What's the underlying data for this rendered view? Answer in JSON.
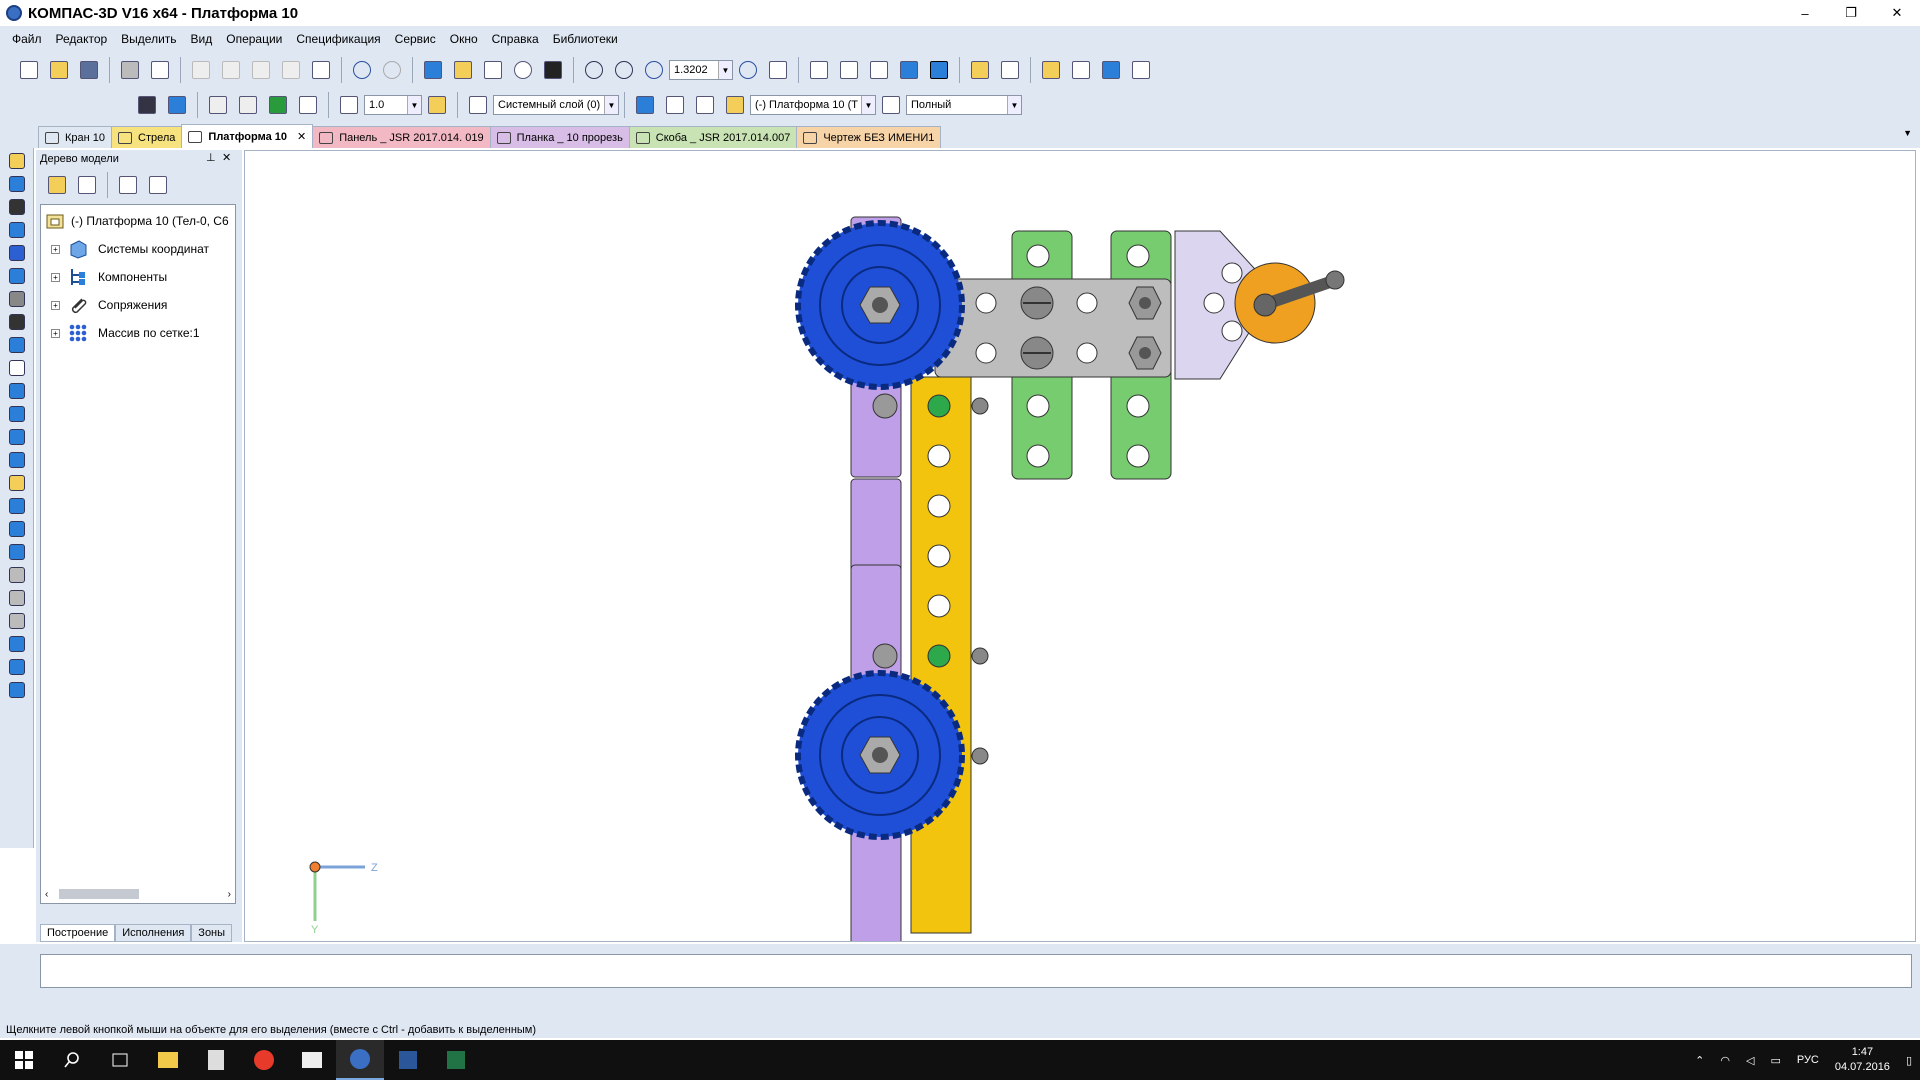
{
  "window": {
    "title": "КОМПАС-3D V16  x64 - Платформа 10",
    "min": "–",
    "restore": "❐",
    "close": "✕"
  },
  "menu": [
    "Файл",
    "Редактор",
    "Выделить",
    "Вид",
    "Операции",
    "Спецификация",
    "Сервис",
    "Окно",
    "Справка",
    "Библиотеки"
  ],
  "toolbar1": {
    "zoom_value": "1.3202"
  },
  "toolbar2": {
    "step_value": "1.0",
    "layer_value": "Системный слой (0)",
    "part_value": "(-) Платформа 10 (Т",
    "mode_value": "Полный"
  },
  "doc_tabs": [
    {
      "label": "Кран 10",
      "color": "#dfe7f3"
    },
    {
      "label": "Стрела",
      "color": "#f6e27e"
    },
    {
      "label": "Платформа 10",
      "color": "#ffffff",
      "active": true
    },
    {
      "label": "Панель _ JSR 2017.014. 019",
      "color": "#f2b9c4"
    },
    {
      "label": "Планка _ 10 прорезь",
      "color": "#d8bde6"
    },
    {
      "label": "Скоба _ JSR 2017.014.007",
      "color": "#c9e3b5"
    },
    {
      "label": "Чертеж БЕЗ ИМЕНИ1",
      "color": "#f7d3a8"
    }
  ],
  "tree": {
    "header": "Дерево модели",
    "root": "(-) Платформа 10 (Тел-0, С6",
    "items": [
      "Системы координат",
      "Компоненты",
      "Сопряжения",
      "Массив по сетке:1"
    ],
    "tabs": [
      "Построение",
      "Исполнения",
      "Зоны"
    ]
  },
  "axis": {
    "z": "Z",
    "y": "Y"
  },
  "status": "Щелкните левой кнопкой мыши на объекте для его выделения (вместе с Ctrl - добавить к выделенным)",
  "taskbar": {
    "lang": "РУС",
    "time": "1:47",
    "date": "04.07.2016"
  },
  "colors": {
    "chrome": "#dfe7f3",
    "wheel": "#1e4fd6",
    "yellow_bar": "#f2c40e",
    "purple": "#bfa0e8",
    "green": "#78cc70",
    "grey_plate": "#bdbdbd",
    "orange": "#f0a020"
  }
}
